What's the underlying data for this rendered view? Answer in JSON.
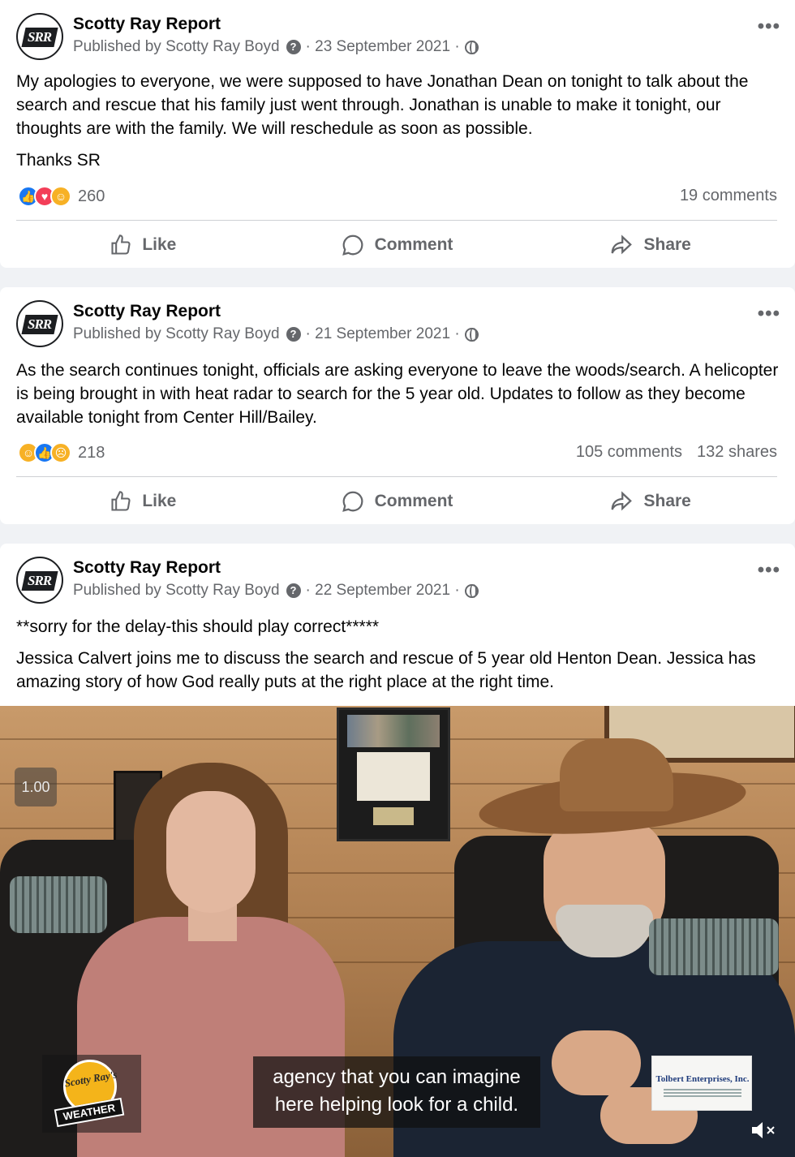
{
  "posts": [
    {
      "page_name": "Scotty Ray Report",
      "avatar_text": "SRR",
      "published_by": "Published by Scotty Ray Boyd",
      "date": "· 23 September 2021 ·",
      "paragraphs": [
        "My apologies to everyone, we were supposed to have Jonathan Dean on tonight to talk about the search and rescue that his family just went through. Jonathan is unable to make it tonight, our thoughts are with the family. We will reschedule as soon as possible.",
        "Thanks SR"
      ],
      "reaction_icons": [
        "like",
        "love",
        "care"
      ],
      "reaction_count": "260",
      "comments": "19 comments",
      "shares": "",
      "actions": {
        "like": "Like",
        "comment": "Comment",
        "share": "Share"
      }
    },
    {
      "page_name": "Scotty Ray Report",
      "avatar_text": "SRR",
      "published_by": "Published by Scotty Ray Boyd",
      "date": "· 21 September 2021 ·",
      "paragraphs": [
        "As the search continues tonight, officials are asking everyone to leave the woods/search. A helicopter is being brought in with heat radar to search for the 5 year old. Updates to follow as they become available tonight from Center Hill/Bailey."
      ],
      "reaction_icons": [
        "care",
        "like",
        "sad"
      ],
      "reaction_count": "218",
      "comments": "105 comments",
      "shares": "132 shares",
      "actions": {
        "like": "Like",
        "comment": "Comment",
        "share": "Share"
      }
    },
    {
      "page_name": "Scotty Ray Report",
      "avatar_text": "SRR",
      "published_by": "Published by Scotty Ray Boyd",
      "date": "· 22 September 2021 ·",
      "paragraphs": [
        "**sorry for the delay-this should play correct*****",
        "Jessica Calvert joins me to discuss the search and rescue of 5 year old Henton Dean. Jessica has amazing story of how God really puts at the right place at the right time."
      ]
    }
  ],
  "video": {
    "playback_speed": "1.00",
    "caption_line1": "agency that you can imagine",
    "caption_line2": "here helping look for a child.",
    "logo_left_script": "Scotty Ray's",
    "logo_left_banner": "WEATHER",
    "sponsor_name": "Tolbert Enterprises, Inc.",
    "volume_icon": "speaker-muted-icon"
  },
  "colors": {
    "like_blue": "#1877f2",
    "love_red": "#f33e58",
    "care_yellow": "#f7b125",
    "secondary_text": "#65676b",
    "background": "#f0f2f5"
  }
}
